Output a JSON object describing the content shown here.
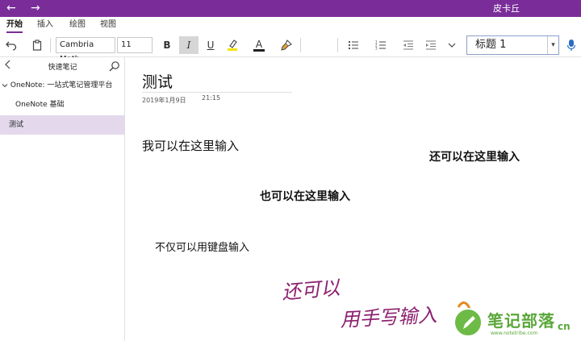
{
  "titlebar": {
    "back": "←",
    "forward": "→",
    "user": "皮卡丘",
    "color": "#7a2d99"
  },
  "menu": {
    "tabs": [
      "开始",
      "插入",
      "绘图",
      "视图"
    ]
  },
  "toolbar": {
    "font_name": "Cambria Math",
    "font_size": "11",
    "bold": "B",
    "italic": "I",
    "underline": "U",
    "font_color": "A",
    "style": "标题 1",
    "dropdown": "▾"
  },
  "sidebar": {
    "header": "快速笔记",
    "notebook": "OneNote: 一站式笔记管理平台",
    "section": "OneNote 基础",
    "page": "测试"
  },
  "page": {
    "title": "测试",
    "date": "2019年1月9日",
    "time": "21:15",
    "texts": [
      "我可以在这里输入",
      "还可以在这里输入",
      "也可以在这里输入",
      "不仅可以用键盘输入"
    ],
    "handwriting": [
      "还可以",
      "用手写输入"
    ]
  },
  "watermark": {
    "text": "笔记部落",
    "suffix": "cn",
    "url": "www.notetribe.com"
  }
}
